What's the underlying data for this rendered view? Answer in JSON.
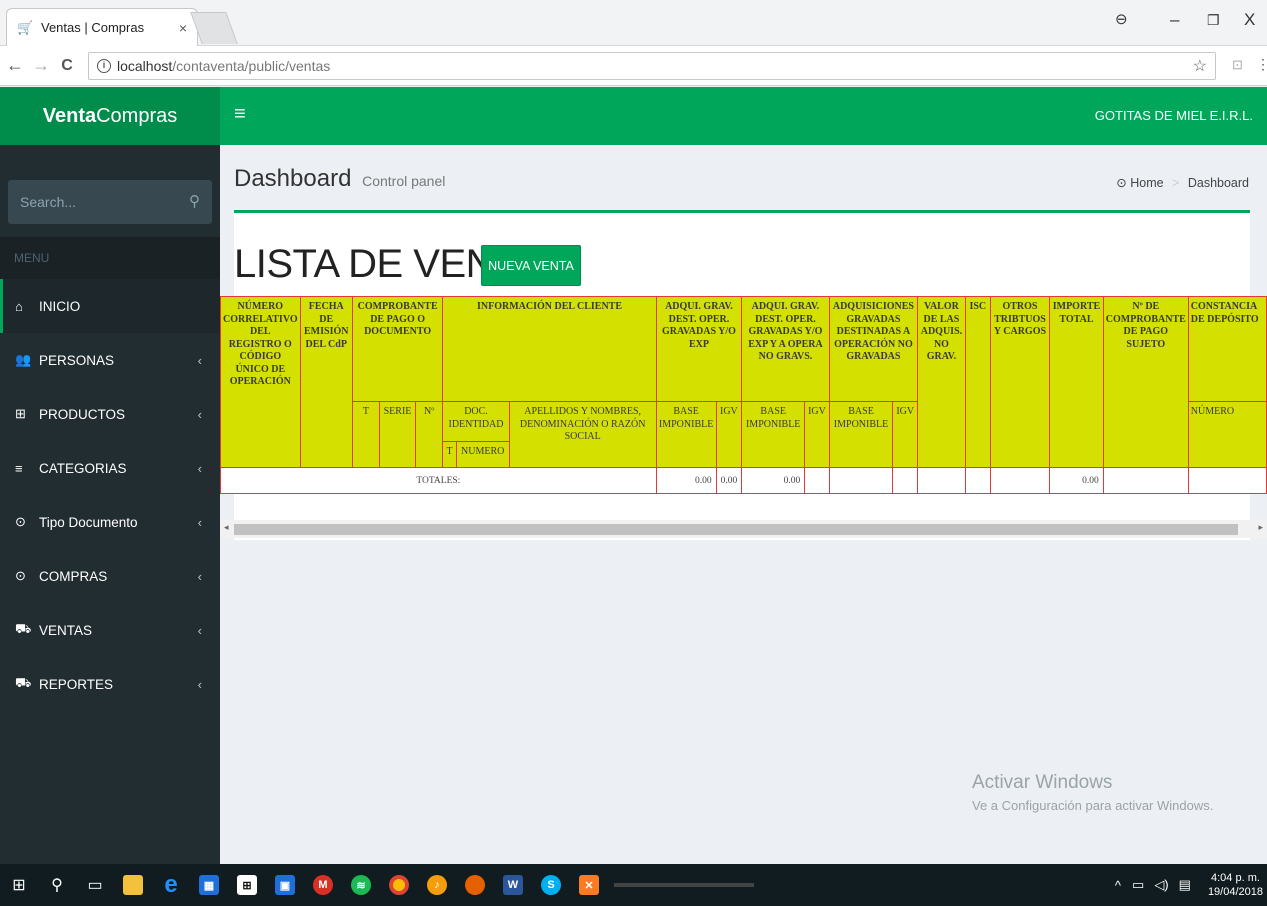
{
  "browser": {
    "tab_title": "Ventas | Compras",
    "tab_close": "×",
    "url_host": "localhost",
    "url_path": "/contaventa/public/ventas",
    "nav_back": "←",
    "nav_forward": "→",
    "nav_reload": "C",
    "star": "☆",
    "profile_icon": "profile-icon",
    "win_minimize": "–",
    "win_maximize": "❐",
    "win_close": "X"
  },
  "app": {
    "logo_bold": "Venta",
    "logo_rest": "Compras",
    "hamburger": "≡",
    "company": "GOTITAS DE MIEL E.I.R.L."
  },
  "sidebar": {
    "search_placeholder": "Search...",
    "menu_header": "MENU",
    "items": [
      {
        "label": "INICIO",
        "icon": "home-icon",
        "glyph": "⌂"
      },
      {
        "label": "PERSONAS",
        "icon": "users-icon",
        "glyph": "👥"
      },
      {
        "label": "PRODUCTOS",
        "icon": "gift-icon",
        "glyph": "⊞"
      },
      {
        "label": "CATEGORIAS",
        "icon": "list-icon",
        "glyph": "≡"
      },
      {
        "label": "Tipo Documento",
        "icon": "car-icon",
        "glyph": "⊙"
      },
      {
        "label": "COMPRAS",
        "icon": "car-icon",
        "glyph": "⊙"
      },
      {
        "label": "VENTAS",
        "icon": "cart-icon",
        "glyph": "⛟"
      },
      {
        "label": "REPORTES",
        "icon": "cart-icon",
        "glyph": "⛟"
      }
    ],
    "chevron": "‹"
  },
  "content": {
    "title": "Dashboard",
    "subtitle": "Control panel",
    "breadcrumb_home": "Home",
    "breadcrumb_sep": ">",
    "breadcrumb_current": "Dashboard",
    "list_title": "LISTA DE VENTAS:",
    "new_button": "NUEVA VENTA"
  },
  "table": {
    "h_numero": "NÚMERO CORRELATIVO DEL REGISTRO O CÓDIGO ÚNICO DE OPERACIÓN",
    "h_fecha": "FECHA DE EMISIÓN DEL CdP",
    "h_comprobante": "COMPROBANTE DE PAGO O DOCUMENTO",
    "h_cliente": "INFORMACIÓN DEL CLIENTE",
    "h_adq1": "ADQUI. GRAV. DEST. OPER. GRAVADAS Y/O EXP",
    "h_adq2": "ADQUI. GRAV. DEST. OPER. GRAVADAS Y/O EXP Y A OPERA NO GRAVS.",
    "h_adq3": "ADQUISICIONES GRAVADAS DESTINADAS A OPERACIÓN NO GRAVADAS",
    "h_valor": "VALOR DE LAS ADQUIS. NO GRAV.",
    "h_isc": "ISC",
    "h_otros": "OTROS TRIBTUOS Y CARGOS",
    "h_importe": "IMPORTE TOTAL",
    "h_ncomp": "Nº DE COMPROBANTE DE PAGO SUJETO",
    "h_const": "CONSTANCIA DE DEPÓSITO",
    "h_t": "T",
    "h_serie": "SERIE",
    "h_no": "Nº",
    "h_docid": "DOC. IDENTIDAD",
    "h_apellidos": "APELLIDOS Y NOMBRES, DENOMINACIÓN O RAZÓN SOCIAL",
    "h_base": "BASE IMPONIBLE",
    "h_igv": "IGV",
    "h_t2": "T",
    "h_numero2": "NUMERO",
    "h_numero_const": "NÚMERO",
    "totales_label": "TOTALES:",
    "tot_base1": "0.00",
    "tot_igv1": "0.00",
    "tot_base2": "0.00",
    "tot_importe": "0.00"
  },
  "watermark": {
    "line1": "Activar Windows",
    "line2": "Ve a Configuración para activar Windows."
  },
  "taskbar": {
    "time": "4:04 p. m.",
    "date": "19/04/2018",
    "tray_chevron": "^",
    "icons": [
      "windows-start-icon",
      "search-icon",
      "task-view-icon",
      "file-explorer-icon",
      "edge-icon",
      "store-icon",
      "shopping-bag-icon",
      "film-icon",
      "gmail-icon",
      "spotify-icon",
      "chrome-icon",
      "fl-studio-icon",
      "firefox-icon",
      "word-icon",
      "skype-icon",
      "xampp-icon"
    ]
  }
}
